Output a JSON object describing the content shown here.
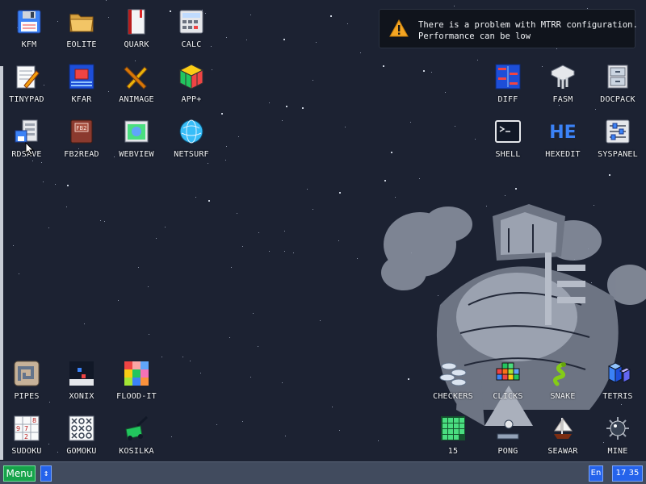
{
  "notification": {
    "line1": "There is a problem with MTRR configuration.",
    "line2": "Performance can be low"
  },
  "icons": {
    "kfm": "KFM",
    "eolite": "EOLITE",
    "quark": "QUARK",
    "calc": "CALC",
    "tinypad": "TINYPAD",
    "kfar": "KFAR",
    "animage": "ANIMAGE",
    "appplus": "APP+",
    "rdsave": "RDSAVE",
    "fb2read": "FB2READ",
    "webview": "WEBVIEW",
    "netsurf": "NETSURF",
    "diff": "DIFF",
    "fasm": "FASM",
    "docpack": "DOCPACK",
    "shell": "SHELL",
    "hexedit": "HEXEDIT",
    "syspanel": "SYSPANEL",
    "pipes": "PIPES",
    "xonix": "XONIX",
    "floodit": "FLOOD-IT",
    "sudoku": "SUDOKU",
    "gomoku": "GOMOKU",
    "kosilka": "KOSILKA",
    "checkers": "CHECKERS",
    "clicks": "CLICKS",
    "snake": "SNAKE",
    "tetris": "TETRIS",
    "fifteen": "15",
    "pong": "PONG",
    "seawar": "SEAWAR",
    "mine": "MINE"
  },
  "taskbar": {
    "menu_label": "Menu",
    "switch_glyph": "↕",
    "language": "En",
    "clock": "17 35"
  }
}
